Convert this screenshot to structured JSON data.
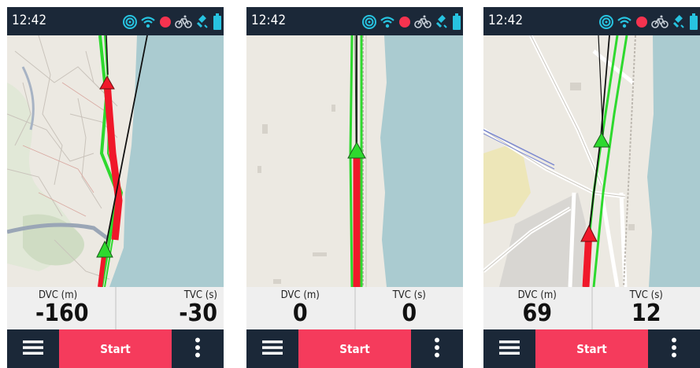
{
  "phones": [
    {
      "time": "12:42",
      "dvc_label": "DVC (m)",
      "dvc_value": "-160",
      "tvc_label": "TVC (s)",
      "tvc_value": "-30",
      "start_label": "Start"
    },
    {
      "time": "12:42",
      "dvc_label": "DVC (m)",
      "dvc_value": "0",
      "tvc_label": "TVC (s)",
      "tvc_value": "0",
      "start_label": "Start"
    },
    {
      "time": "12:42",
      "dvc_label": "DVC (m)",
      "dvc_value": "69",
      "tvc_label": "TVC (s)",
      "tvc_value": "12",
      "start_label": "Start"
    }
  ],
  "status_icons": [
    "live-tracking-icon",
    "wifi-icon",
    "recording-dot-icon",
    "bike-icon",
    "gps-satellite-icon",
    "battery-icon"
  ],
  "colors": {
    "status_bar": "#1b2838",
    "start_button": "#f53b5c",
    "icon_accent": "#27c3e0",
    "record_dot": "#f5334f",
    "route_red": "#f0182a",
    "route_green": "#2ed92e",
    "water": "#aacbd0",
    "land": "#ece9e2"
  }
}
